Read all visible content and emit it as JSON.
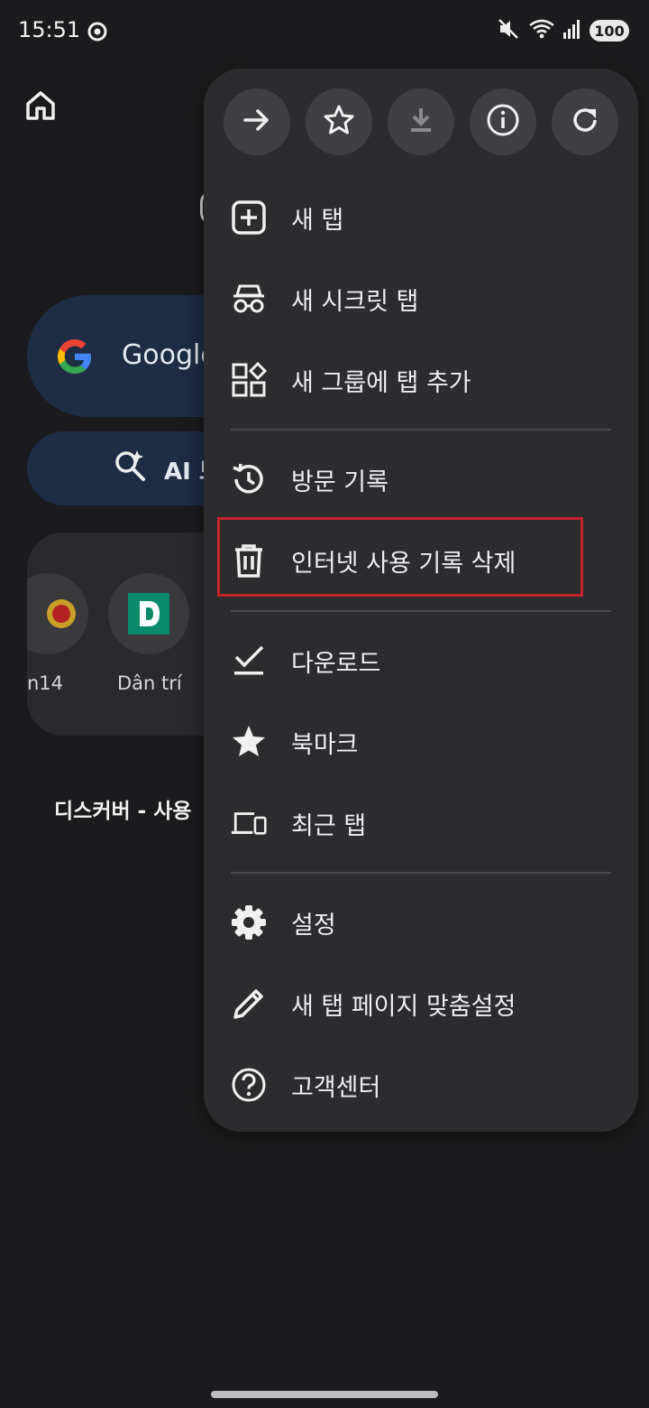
{
  "status_bar": {
    "time": "15:51",
    "battery": "100",
    "icons": [
      "chrome-icon",
      "mute-icon",
      "wifi-icon",
      "signal-icon",
      "battery-icon"
    ]
  },
  "background": {
    "search_text": "Google",
    "ai_text": "AI 모",
    "tiles": [
      {
        "label": "n14"
      },
      {
        "label": "Dân trí"
      }
    ],
    "discover_text": "디스커버 - 사용"
  },
  "menu": {
    "top_actions": [
      {
        "name": "forward-icon"
      },
      {
        "name": "bookmark-star-icon"
      },
      {
        "name": "download-page-icon"
      },
      {
        "name": "page-info-icon"
      },
      {
        "name": "reload-icon"
      }
    ],
    "items": [
      {
        "label": "새 탭",
        "icon": "new-tab-icon"
      },
      {
        "label": "새 시크릿 탭",
        "icon": "incognito-icon"
      },
      {
        "label": "새 그룹에 탭 추가",
        "icon": "tab-group-icon"
      },
      {
        "label": "방문 기록",
        "icon": "history-icon"
      },
      {
        "label": "인터넷 사용 기록 삭제",
        "icon": "trash-icon"
      },
      {
        "label": "다운로드",
        "icon": "downloads-icon"
      },
      {
        "label": "북마크",
        "icon": "bookmarks-star-icon"
      },
      {
        "label": "최근 탭",
        "icon": "recent-tabs-icon"
      },
      {
        "label": "설정",
        "icon": "settings-gear-icon"
      },
      {
        "label": "새 탭 페이지 맞춤설정",
        "icon": "pencil-icon"
      },
      {
        "label": "고객센터",
        "icon": "help-icon"
      }
    ]
  },
  "colors": {
    "background": "#1b1b1d",
    "menu": "#2c2c2f",
    "highlight": "#c4232b",
    "pill": "#1e2c44"
  }
}
